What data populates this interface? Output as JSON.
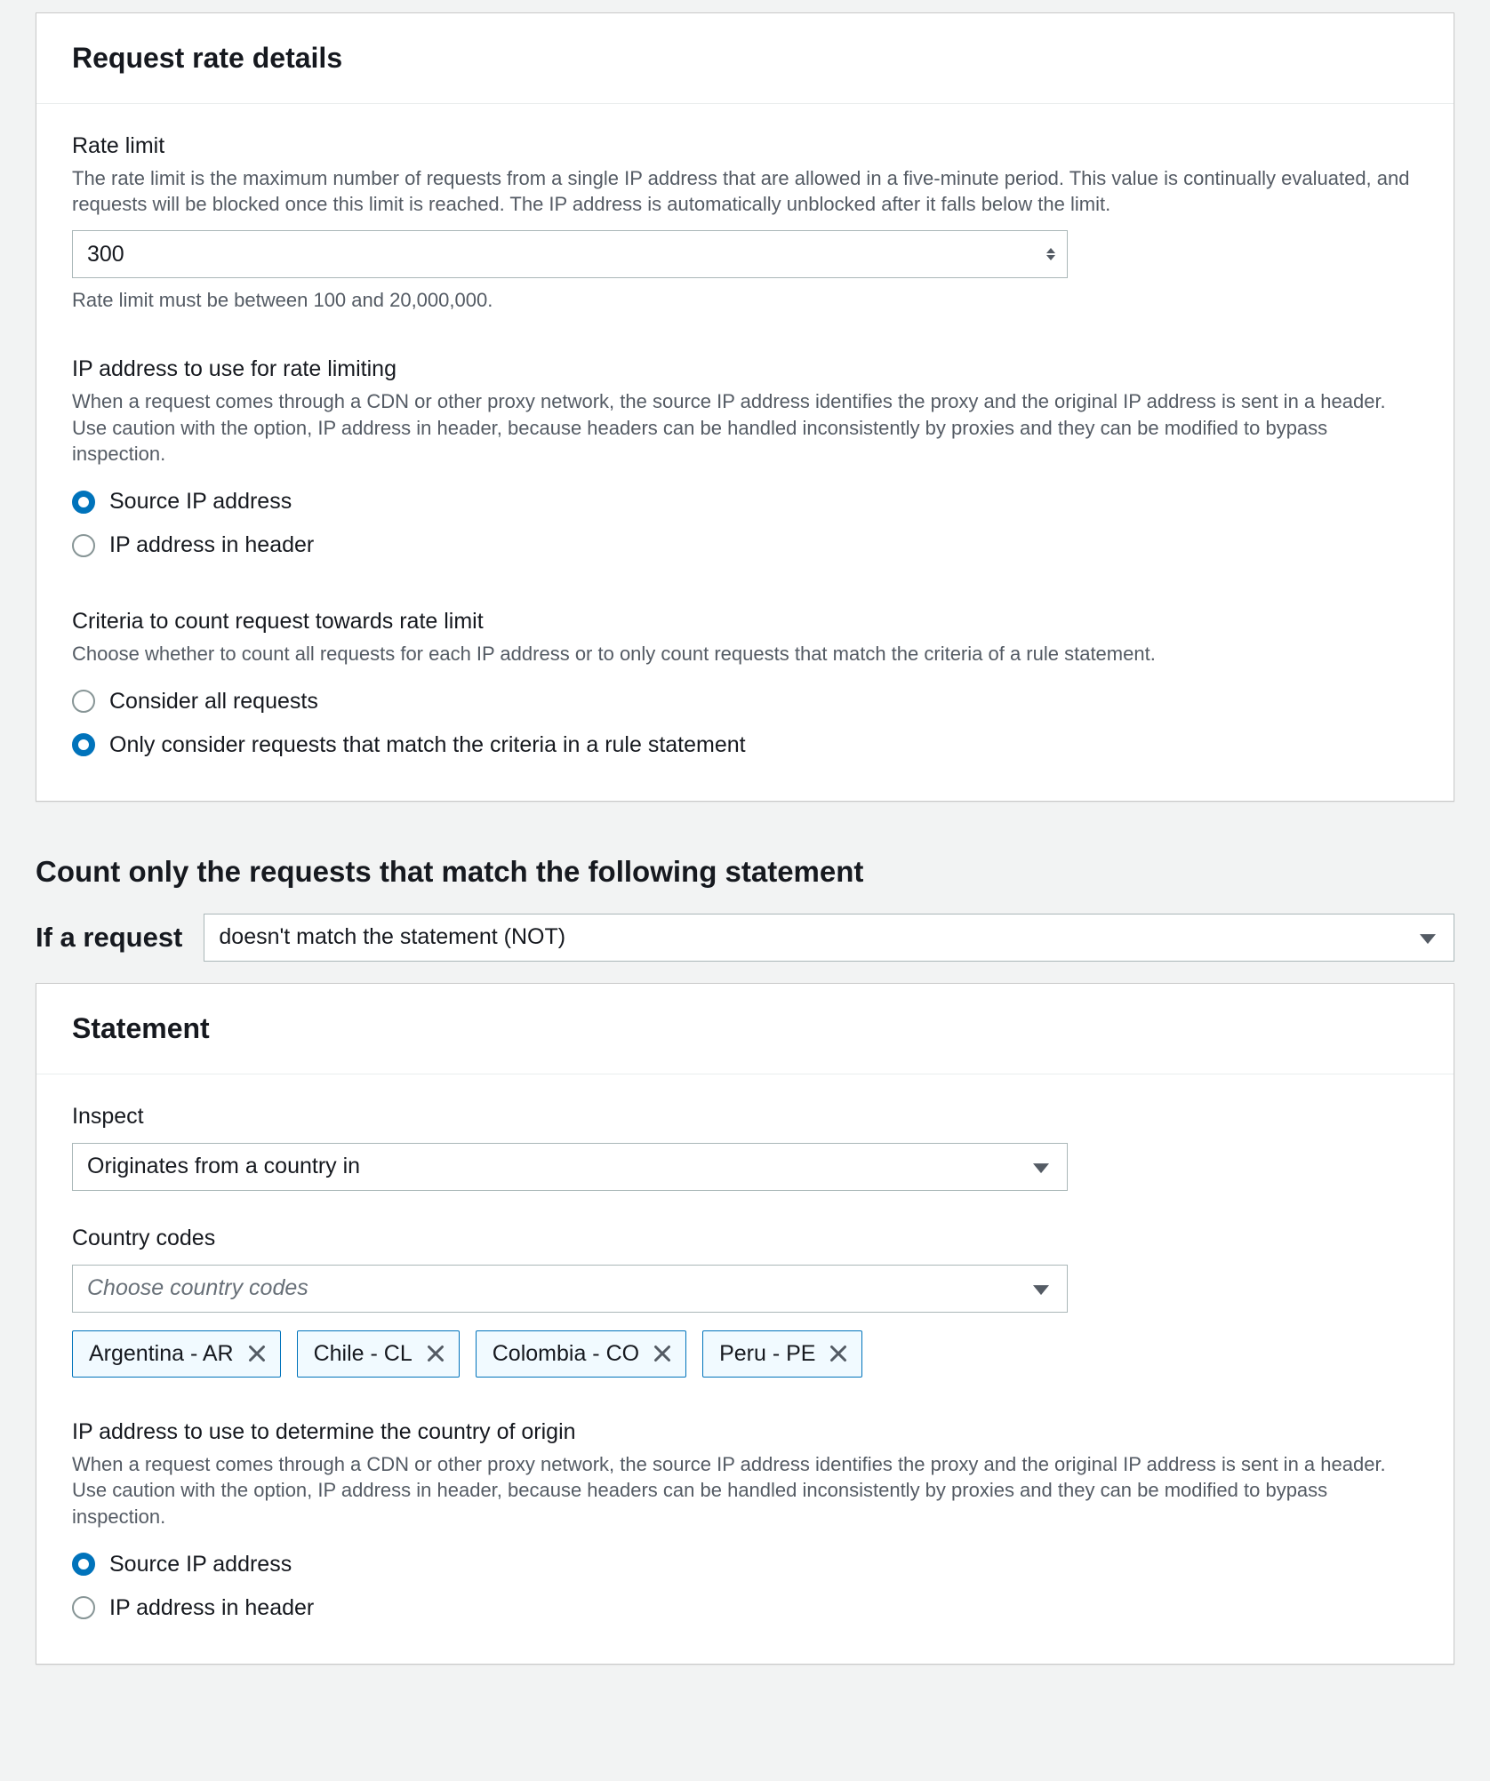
{
  "rate_panel": {
    "title": "Request rate details",
    "rate_limit": {
      "label": "Rate limit",
      "description": "The rate limit is the maximum number of requests from a single IP address that are allowed in a five-minute period. This value is continually evaluated, and requests will be blocked once this limit is reached. The IP address is automatically unblocked after it falls below the limit.",
      "value": "300",
      "hint": "Rate limit must be between 100 and 20,000,000."
    },
    "ip_rate": {
      "label": "IP address to use for rate limiting",
      "description": "When a request comes through a CDN or other proxy network, the source IP address identifies the proxy and the original IP address is sent in a header. Use caution with the option, IP address in header, because headers can be handled inconsistently by proxies and they can be modified to bypass inspection.",
      "options": [
        "Source IP address",
        "IP address in header"
      ],
      "selected": 0
    },
    "criteria": {
      "label": "Criteria to count request towards rate limit",
      "description": "Choose whether to count all requests for each IP address or to only count requests that match the criteria of a rule statement.",
      "options": [
        "Consider all requests",
        "Only consider requests that match the criteria in a rule statement"
      ],
      "selected": 1
    }
  },
  "count_section": {
    "heading": "Count only the requests that match the following statement",
    "if_label": "If a request",
    "if_value": "doesn't match the statement (NOT)"
  },
  "statement_panel": {
    "title": "Statement",
    "inspect": {
      "label": "Inspect",
      "value": "Originates from a country in"
    },
    "country_codes": {
      "label": "Country codes",
      "placeholder": "Choose country codes",
      "selected": [
        "Argentina - AR",
        "Chile - CL",
        "Colombia - CO",
        "Peru - PE"
      ]
    },
    "ip_origin": {
      "label": "IP address to use to determine the country of origin",
      "description": "When a request comes through a CDN or other proxy network, the source IP address identifies the proxy and the original IP address is sent in a header. Use caution with the option, IP address in header, because headers can be handled inconsistently by proxies and they can be modified to bypass inspection.",
      "options": [
        "Source IP address",
        "IP address in header"
      ],
      "selected": 0
    }
  }
}
